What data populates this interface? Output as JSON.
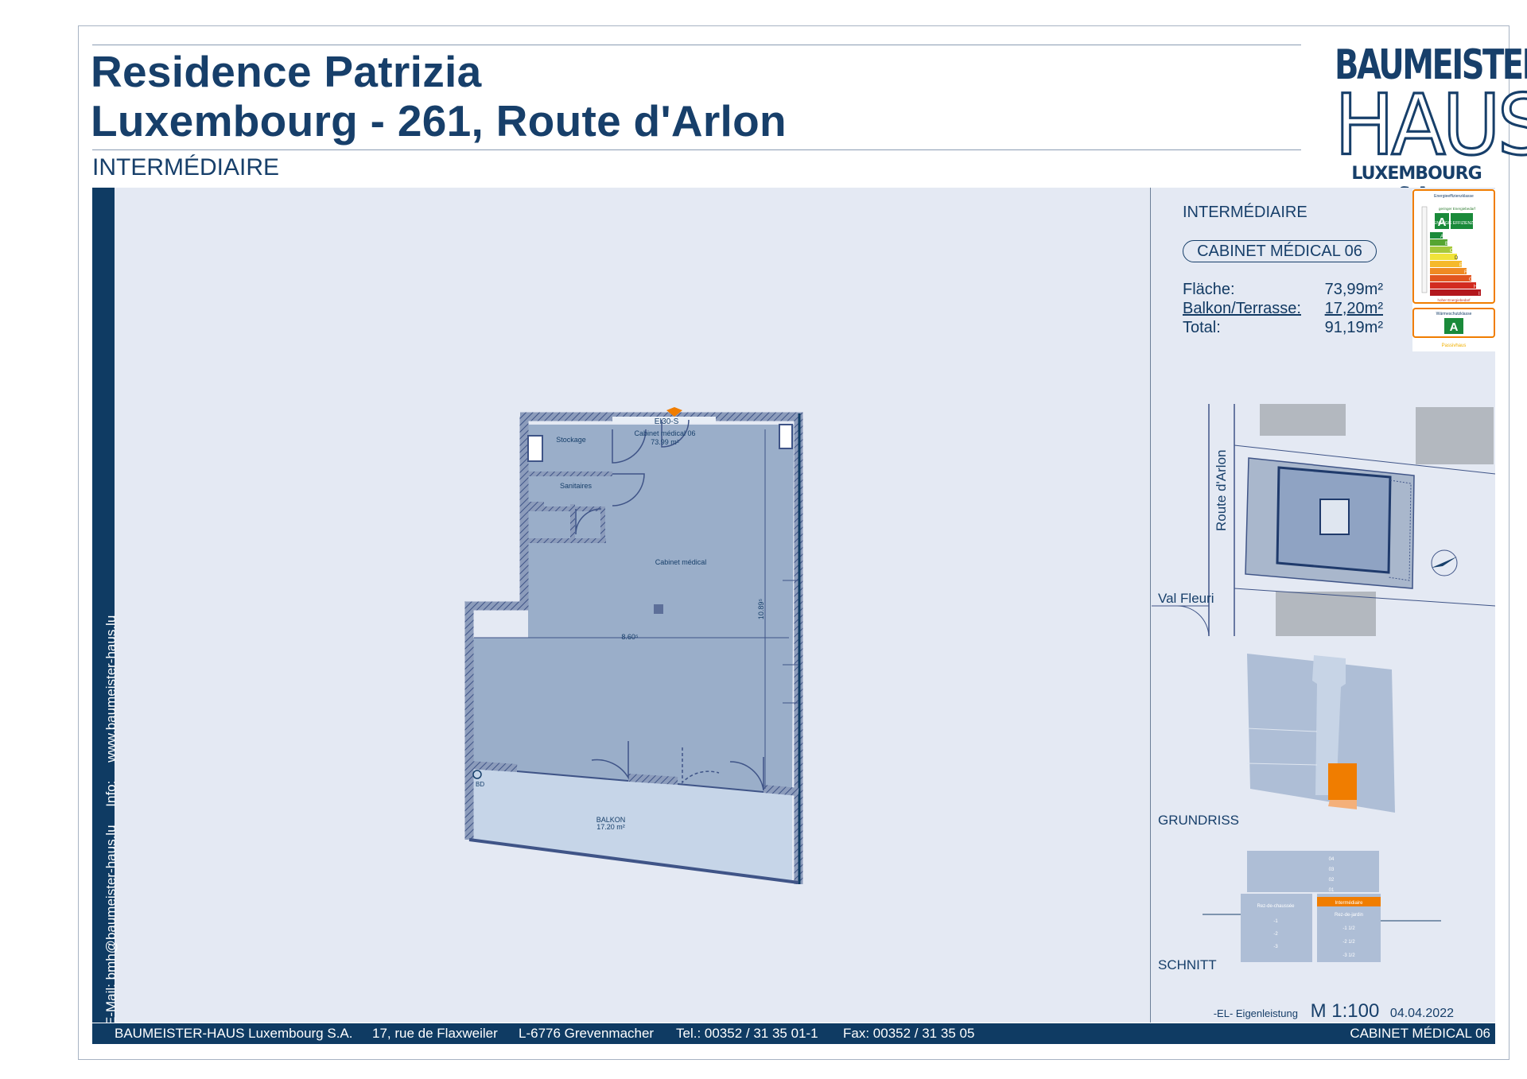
{
  "header": {
    "title_line1": "Residence Patrizia",
    "title_line2": "Luxembourg - 261, Route d'Arlon",
    "level": "INTERMÉDIAIRE"
  },
  "logo": {
    "line1": "BAUMEISTER",
    "line2": "HAUS",
    "line3": "LUXEMBOURG S.A."
  },
  "sidebar": {
    "email": "E-Mail: bmh@baumeister-haus.lu",
    "info_label": "Info:",
    "website": "www.baumeister-haus.lu"
  },
  "panel": {
    "level": "INTERMÉDIAIRE",
    "unit": "CABINET MÉDICAL 06",
    "areas": [
      {
        "label": "Fläche:",
        "value": "73,99m²"
      },
      {
        "label": "Balkon/Terrasse:",
        "value": "17,20m²"
      },
      {
        "label": "Total:",
        "value": "91,19m²"
      }
    ],
    "energy": {
      "header": "Energieeffizienzklasse",
      "sublabel": "geringer Energiebedarf",
      "class": "A",
      "class_text": "ENERGIE EFFIZIENZ KLASSE",
      "bottom_label": "hoher Energiebedarf",
      "thermal_header": "Wärmeschutzklasse",
      "thermal_class": "A",
      "thermal_label": "Passivhaus",
      "scale": [
        "A",
        "B",
        "C",
        "D",
        "E",
        "F",
        "G",
        "H",
        "I"
      ]
    },
    "site_plan": {
      "street1": "Route d'Arlon",
      "street2": "Val Fleuri"
    },
    "grundriss_label": "GRUNDRISS",
    "schnitt_label": "SCHNITT",
    "section": {
      "right_levels": [
        "04",
        "03",
        "02",
        "01",
        "Intermédiaire",
        "Rez-de-jardin",
        "-1 1/2",
        "-2 1/2",
        "-3 1/2"
      ],
      "left_levels": [
        "Rez-de-chaussée",
        "-1",
        "-2",
        "-3"
      ]
    }
  },
  "plan": {
    "tag": "EI30-S",
    "unit_name": "Cabinet médical 06",
    "unit_area": "73.99 m²",
    "rooms": {
      "stockage": "Stockage",
      "sanitaires": "Sanitaires",
      "cabinet": "Cabinet médical"
    },
    "dims": {
      "width": "8.60⁵",
      "height": "10.89⁵"
    },
    "bd": "BD",
    "balkon": "BALKON",
    "balkon_area": "17.20 m²"
  },
  "footer": {
    "company": "BAUMEISTER-HAUS Luxembourg S.A.",
    "street": "17, rue de Flaxweiler",
    "city": "L-6776 Grevenmacher",
    "tel": "Tel.: 00352 / 31 35 01-1",
    "fax": "Fax: 00352 / 31 35 05",
    "unit": "CABINET MÉDICAL 06"
  },
  "scale": {
    "eigenleistung": "-EL- Eigenleistung",
    "ratio": "M 1:100",
    "date": "04.04.2022"
  }
}
